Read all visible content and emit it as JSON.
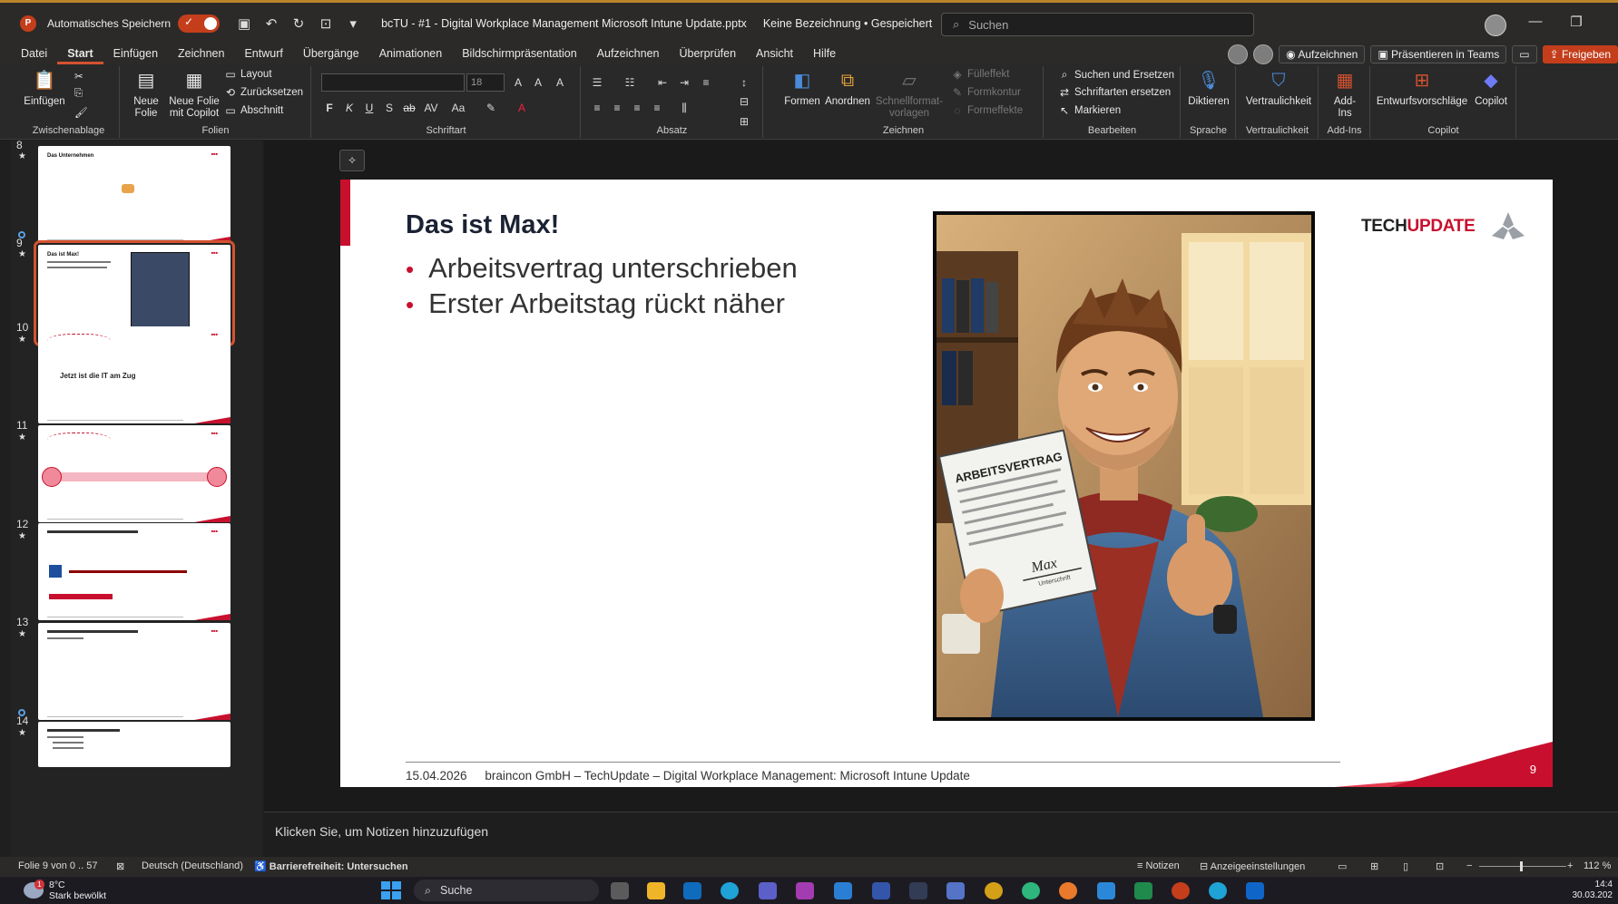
{
  "titlebar": {
    "autosave_label": "Automatisches Speichern",
    "doc_title": "bcTU - #1 - Digital Workplace Management Microsoft Intune Update.pptx",
    "label_status": "Keine Bezeichnung • Gespeichert",
    "search_placeholder": "Suchen"
  },
  "menu": {
    "tabs": [
      "Datei",
      "Start",
      "Einfügen",
      "Zeichnen",
      "Entwurf",
      "Übergänge",
      "Animationen",
      "Bildschirmpräsentation",
      "Aufzeichnen",
      "Überprüfen",
      "Ansicht",
      "Hilfe"
    ],
    "active": "Start",
    "record_label": "Aufzeichnen",
    "teams_label": "Präsentieren in Teams",
    "share_label": "Freigeben"
  },
  "ribbon": {
    "groups": {
      "clipboard": "Zwischenablage",
      "slides": "Folien",
      "font": "Schriftart",
      "paragraph": "Absatz",
      "drawing": "Zeichnen",
      "editing": "Bearbeiten",
      "voice": "Sprache",
      "sensitivity": "Vertraulichkeit",
      "addins": "Add-Ins",
      "copilot": "Copilot"
    },
    "paste": "Einfügen",
    "new_slide": "Neue Folie",
    "new_slide_copilot_1": "Neue Folie",
    "new_slide_copilot_2": "mit Copilot",
    "layout": "Layout",
    "reset": "Zurücksetzen",
    "section": "Abschnitt",
    "font_size": "18",
    "shapes": "Formen",
    "arrange": "Anordnen",
    "quick_styles_1": "Schnellformat-",
    "quick_styles_2": "vorlagen",
    "fill": "Fülleffekt",
    "outline": "Formkontur",
    "effects": "Formeffekte",
    "find": "Suchen und Ersetzen",
    "replace_fonts": "Schriftarten ersetzen",
    "select": "Markieren",
    "dictate": "Diktieren",
    "sensitivity": "Vertraulichkeit",
    "addins_1": "Add-",
    "addins_2": "Ins",
    "designer": "Entwurfsvorschläge",
    "copilot": "Copilot"
  },
  "thumbnails": [
    {
      "num": "8",
      "title": "Das Unternehmen"
    },
    {
      "num": "9",
      "title": "Das ist Max!"
    },
    {
      "num": "10",
      "title": "Jetzt ist die IT am Zug"
    },
    {
      "num": "11",
      "title": ""
    },
    {
      "num": "12",
      "title": ""
    },
    {
      "num": "13",
      "title": ""
    },
    {
      "num": "14",
      "title": ""
    }
  ],
  "slide": {
    "title": "Das ist Max!",
    "bullets": [
      "Arbeitsvertrag unterschrieben",
      "Erster Arbeitstag rückt näher"
    ],
    "brand_tech": "TECH",
    "brand_update": "UPDATE",
    "footer_date": "15.04.2026",
    "footer_text": "braincon GmbH – TechUpdate – Digital Workplace Management: Microsoft Intune Update",
    "page_number": "9",
    "image_caption": "ARBEITSVERTRAG",
    "image_signature": "Max",
    "image_signature_label": "Unterschrift"
  },
  "notes_placeholder": "Klicken Sie, um Notizen hinzuzufügen",
  "status": {
    "slide_info": "Folie 9 von 0 .. 57",
    "language": "Deutsch (Deutschland)",
    "accessibility": "Barrierefreiheit: Untersuchen",
    "notes": "Notizen",
    "display_settings": "Anzeigeeinstellungen",
    "zoom": "112 %"
  },
  "taskbar": {
    "weather_temp": "8°C",
    "weather_desc": "Stark bewölkt",
    "weather_badge": "1",
    "search": "Suche",
    "time": "14:4",
    "date": "30.03.202"
  },
  "colors": {
    "accent": "#d35230",
    "brand_red": "#c8102e"
  }
}
